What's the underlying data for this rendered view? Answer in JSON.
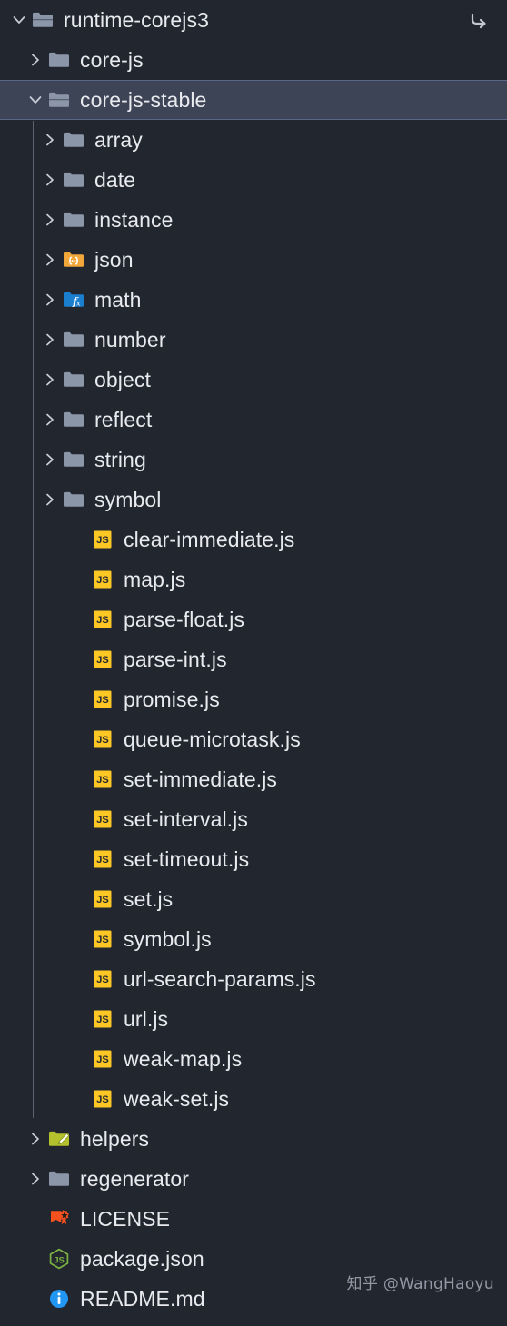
{
  "window": {
    "title": "runtime-corejs3",
    "theme": "dark",
    "background_color": "#22262f",
    "selected_row_color": "#3d4456",
    "text_color": "#e8eaee"
  },
  "top_action": {
    "name": "go-to-arrow",
    "label": "↳"
  },
  "watermark": {
    "text": "知乎 @WangHaoyu"
  },
  "tree": {
    "items": [
      {
        "label": "runtime-corejs3",
        "depth": 0,
        "kind": "folder",
        "icon": "folder-open-icon",
        "state": "expanded",
        "selected": false
      },
      {
        "label": "core-js",
        "depth": 1,
        "kind": "folder",
        "icon": "folder-icon",
        "state": "collapsed",
        "selected": false
      },
      {
        "label": "core-js-stable",
        "depth": 1,
        "kind": "folder",
        "icon": "folder-open-icon",
        "state": "expanded",
        "selected": true
      },
      {
        "label": "array",
        "depth": 2,
        "kind": "folder",
        "icon": "folder-icon",
        "state": "collapsed",
        "selected": false
      },
      {
        "label": "date",
        "depth": 2,
        "kind": "folder",
        "icon": "folder-icon",
        "state": "collapsed",
        "selected": false
      },
      {
        "label": "instance",
        "depth": 2,
        "kind": "folder",
        "icon": "folder-icon",
        "state": "collapsed",
        "selected": false
      },
      {
        "label": "json",
        "depth": 2,
        "kind": "folder",
        "icon": "folder-json-icon",
        "state": "collapsed",
        "selected": false
      },
      {
        "label": "math",
        "depth": 2,
        "kind": "folder",
        "icon": "folder-math-icon",
        "state": "collapsed",
        "selected": false
      },
      {
        "label": "number",
        "depth": 2,
        "kind": "folder",
        "icon": "folder-icon",
        "state": "collapsed",
        "selected": false
      },
      {
        "label": "object",
        "depth": 2,
        "kind": "folder",
        "icon": "folder-icon",
        "state": "collapsed",
        "selected": false
      },
      {
        "label": "reflect",
        "depth": 2,
        "kind": "folder",
        "icon": "folder-icon",
        "state": "collapsed",
        "selected": false
      },
      {
        "label": "string",
        "depth": 2,
        "kind": "folder",
        "icon": "folder-icon",
        "state": "collapsed",
        "selected": false
      },
      {
        "label": "symbol",
        "depth": 2,
        "kind": "folder",
        "icon": "folder-icon",
        "state": "collapsed",
        "selected": false
      },
      {
        "label": "clear-immediate.js",
        "depth": 3,
        "kind": "file",
        "icon": "javascript-icon",
        "state": "leaf",
        "selected": false
      },
      {
        "label": "map.js",
        "depth": 3,
        "kind": "file",
        "icon": "javascript-icon",
        "state": "leaf",
        "selected": false
      },
      {
        "label": "parse-float.js",
        "depth": 3,
        "kind": "file",
        "icon": "javascript-icon",
        "state": "leaf",
        "selected": false
      },
      {
        "label": "parse-int.js",
        "depth": 3,
        "kind": "file",
        "icon": "javascript-icon",
        "state": "leaf",
        "selected": false
      },
      {
        "label": "promise.js",
        "depth": 3,
        "kind": "file",
        "icon": "javascript-icon",
        "state": "leaf",
        "selected": false
      },
      {
        "label": "queue-microtask.js",
        "depth": 3,
        "kind": "file",
        "icon": "javascript-icon",
        "state": "leaf",
        "selected": false
      },
      {
        "label": "set-immediate.js",
        "depth": 3,
        "kind": "file",
        "icon": "javascript-icon",
        "state": "leaf",
        "selected": false
      },
      {
        "label": "set-interval.js",
        "depth": 3,
        "kind": "file",
        "icon": "javascript-icon",
        "state": "leaf",
        "selected": false
      },
      {
        "label": "set-timeout.js",
        "depth": 3,
        "kind": "file",
        "icon": "javascript-icon",
        "state": "leaf",
        "selected": false
      },
      {
        "label": "set.js",
        "depth": 3,
        "kind": "file",
        "icon": "javascript-icon",
        "state": "leaf",
        "selected": false
      },
      {
        "label": "symbol.js",
        "depth": 3,
        "kind": "file",
        "icon": "javascript-icon",
        "state": "leaf",
        "selected": false
      },
      {
        "label": "url-search-params.js",
        "depth": 3,
        "kind": "file",
        "icon": "javascript-icon",
        "state": "leaf",
        "selected": false
      },
      {
        "label": "url.js",
        "depth": 3,
        "kind": "file",
        "icon": "javascript-icon",
        "state": "leaf",
        "selected": false
      },
      {
        "label": "weak-map.js",
        "depth": 3,
        "kind": "file",
        "icon": "javascript-icon",
        "state": "leaf",
        "selected": false
      },
      {
        "label": "weak-set.js",
        "depth": 3,
        "kind": "file",
        "icon": "javascript-icon",
        "state": "leaf",
        "selected": false
      },
      {
        "label": "helpers",
        "depth": 1,
        "kind": "folder",
        "icon": "folder-helpers-icon",
        "state": "collapsed",
        "selected": false
      },
      {
        "label": "regenerator",
        "depth": 1,
        "kind": "folder",
        "icon": "folder-icon",
        "state": "collapsed",
        "selected": false
      },
      {
        "label": "LICENSE",
        "depth": 1,
        "kind": "file",
        "icon": "license-icon",
        "state": "leaf",
        "selected": false
      },
      {
        "label": "package.json",
        "depth": 1,
        "kind": "file",
        "icon": "nodejs-icon",
        "state": "leaf",
        "selected": false
      },
      {
        "label": "README.md",
        "depth": 1,
        "kind": "file",
        "icon": "readme-info-icon",
        "state": "leaf",
        "selected": false
      }
    ]
  },
  "icon_colors": {
    "folder": "#8b97a8",
    "folder_json": "#f2a73b",
    "folder_math": "#1b7fd0",
    "folder_helpers": "#b3c12c",
    "javascript": "#fcc624",
    "license": "#f4511e",
    "nodejs": "#7cb342",
    "readme": "#2196f3"
  }
}
